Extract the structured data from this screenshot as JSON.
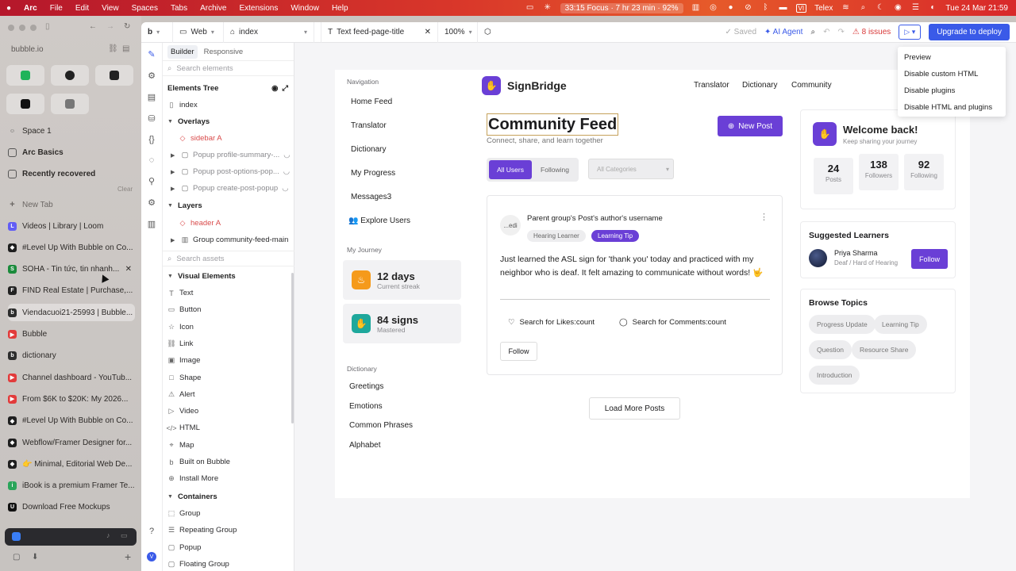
{
  "menubar": {
    "app": "Arc",
    "items": [
      "File",
      "Edit",
      "View",
      "Spaces",
      "Tabs",
      "Archive",
      "Extensions",
      "Window",
      "Help"
    ],
    "focus": "33:15 Focus · 7 hr 23 min · 92%",
    "user_initials": "VI",
    "telex": "Telex",
    "datetime": "Tue 24 Mar  21:59"
  },
  "arc": {
    "url": "bubble.io",
    "space": "Space 1",
    "pinned": [
      {
        "label": "Arc Basics",
        "icon": "folder-icon"
      },
      {
        "label": "Recently recovered",
        "icon": "folder-icon"
      }
    ],
    "clear": "Clear",
    "new_tab": "New Tab",
    "tabs": [
      {
        "label": "Videos | Library | Loom",
        "color": "#625df5",
        "letter": "L"
      },
      {
        "label": "#Level Up With Bubble on Co...",
        "color": "#1f1f1f",
        "letter": "◆"
      },
      {
        "label": "SOHA - Tin tức, tin nhanh...",
        "color": "#1b8b3c",
        "letter": "S"
      },
      {
        "label": "FIND Real Estate | Purchase,...",
        "color": "#222",
        "letter": "F"
      },
      {
        "label": "Viendacuoi21-25993 | Bubble...",
        "color": "#2d2d2d",
        "letter": "b"
      },
      {
        "label": "Bubble",
        "color": "#e23b3b",
        "letter": "▶"
      },
      {
        "label": "dictionary",
        "color": "#2d2d2d",
        "letter": "b"
      },
      {
        "label": "Channel dashboard - YouTub...",
        "color": "#e23b3b",
        "letter": "▶"
      },
      {
        "label": "From $6K to $20K: My 2026...",
        "color": "#e23b3b",
        "letter": "▶"
      },
      {
        "label": "#Level Up With Bubble on Co...",
        "color": "#1f1f1f",
        "letter": "◆"
      },
      {
        "label": "Webflow/Framer Designer for...",
        "color": "#1f1f1f",
        "letter": "◆"
      },
      {
        "label": "👉 Minimal, Editorial Web De...",
        "color": "#1f1f1f",
        "letter": "◆"
      },
      {
        "label": "iBook is a premium Framer Te...",
        "color": "#2aa55a",
        "letter": "i"
      },
      {
        "label": "Download Free Mockups",
        "color": "#111",
        "letter": "U"
      }
    ]
  },
  "toolbar": {
    "env": "Web",
    "page": "index",
    "element": "Text feed-page-title",
    "zoom": "100%",
    "saved": "Saved",
    "ai": "AI Agent",
    "issues": "8 issues",
    "deploy": "Upgrade to deploy"
  },
  "dropdown": [
    "Preview",
    "Disable custom HTML",
    "Disable plugins",
    "Disable HTML and plugins"
  ],
  "builder": {
    "tabs": [
      "Builder",
      "Responsive"
    ],
    "search_elements": "Search elements",
    "tree_title": "Elements Tree",
    "tree": {
      "index": "index",
      "overlays": "Overlays",
      "sidebar": "sidebar A",
      "popup1": "Popup profile-summary-...",
      "popup2": "Popup post-options-pop...",
      "popup3": "Popup create-post-popup",
      "layers": "Layers",
      "header": "header A",
      "group": "Group community-feed-main"
    },
    "search_assets": "Search assets",
    "visual_title": "Visual Elements",
    "visual": [
      {
        "label": "Text",
        "icon": "T"
      },
      {
        "label": "Button",
        "icon": "▭"
      },
      {
        "label": "Icon",
        "icon": "☆"
      },
      {
        "label": "Link",
        "icon": "⛓"
      },
      {
        "label": "Image",
        "icon": "▣"
      },
      {
        "label": "Shape",
        "icon": "□"
      },
      {
        "label": "Alert",
        "icon": "⚠"
      },
      {
        "label": "Video",
        "icon": "▷"
      },
      {
        "label": "HTML",
        "icon": "</>"
      },
      {
        "label": "Map",
        "icon": "⌖"
      },
      {
        "label": "Built on Bubble",
        "icon": "b"
      },
      {
        "label": "Install More",
        "icon": "⊕"
      }
    ],
    "containers_title": "Containers",
    "containers": [
      {
        "label": "Group",
        "icon": "⬚"
      },
      {
        "label": "Repeating Group",
        "icon": "☰"
      },
      {
        "label": "Popup",
        "icon": "▢"
      },
      {
        "label": "Floating Group",
        "icon": "▢"
      }
    ]
  },
  "app": {
    "nav_section": "Navigation",
    "nav": [
      "Home Feed",
      "Translator",
      "Dictionary",
      "My Progress",
      "Messages3",
      "Explore Users"
    ],
    "journey_section": "My Journey",
    "streak_value": "12 days",
    "streak_label": "Current streak",
    "signs_value": "84 signs",
    "signs_label": "Mastered",
    "dict_section": "Dictionary",
    "dict": [
      "Greetings",
      "Emotions",
      "Common Phrases",
      "Alphabet"
    ],
    "brand": "SignBridge",
    "topnav": [
      "Translator",
      "Dictionary",
      "Community"
    ],
    "feed_title": "Community Feed",
    "feed_subtitle": "Connect, share, and learn together",
    "new_post": "New Post",
    "filter_all": "All Users",
    "filter_following": "Following",
    "categories": "All Categories",
    "post": {
      "avatar_text": "...edi",
      "author": "Parent group's Post's author's username",
      "tag1": "Hearing Learner",
      "tag2": "Learning Tip",
      "text": "Just learned the ASL sign for 'thank you' today and practiced with my neighbor who is deaf. It felt amazing to communicate without words! 🤟",
      "likes": "Search for Likes:count",
      "comments": "Search for Comments:count",
      "follow": "Follow"
    },
    "load_more": "Load More Posts",
    "welcome": "Welcome back!",
    "welcome_sub": "Keep sharing your journey",
    "stats": [
      {
        "v": "24",
        "l": "Posts"
      },
      {
        "v": "138",
        "l": "Followers"
      },
      {
        "v": "92",
        "l": "Following"
      }
    ],
    "suggested_title": "Suggested Learners",
    "learner_name": "Priya Sharma",
    "learner_sub": "Deaf / Hard of Hearing",
    "learner_follow": "Follow",
    "topics_title": "Browse Topics",
    "topics": [
      "Progress Update",
      "Learning Tip",
      "Question",
      "Resource Share",
      "Introduction"
    ]
  },
  "colors": {
    "accent": "#6a3fd6",
    "deploy": "#3a5ae8",
    "streak": "#f59a1b",
    "signs": "#1ea89c"
  }
}
